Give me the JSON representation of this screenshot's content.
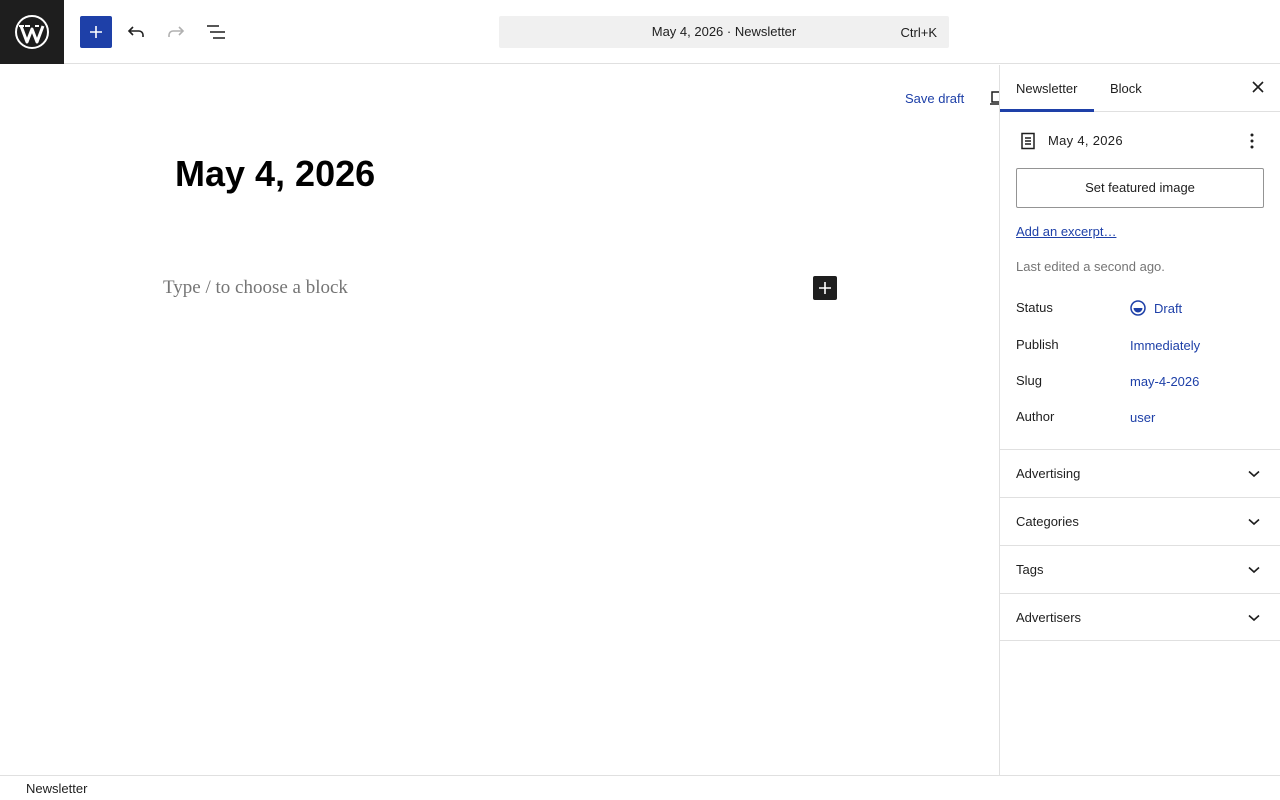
{
  "colors": {
    "accent": "#1e40a8",
    "toolbar_dark": "#1e1e1e",
    "muted_text": "#757575",
    "border": "#e0e0e0",
    "command_bg": "#f0f0f0"
  },
  "icons": {
    "logo": "wordpress-logo-icon",
    "inserter": "plus-icon",
    "undo": "undo-icon",
    "redo": "redo-icon",
    "list_view": "list-view-icon",
    "preview": "desktop-preview-icon",
    "close": "close-icon",
    "document": "post-document-icon",
    "more": "more-vertical-icon",
    "status": "draft-status-icon",
    "chevron": "chevron-down-icon"
  },
  "toolbar": {
    "command": {
      "title": "May 4, 2026 · Newsletter",
      "shortcut": "Ctrl+K"
    }
  },
  "editor": {
    "save_draft": "Save draft",
    "post_title": "May 4, 2026",
    "block_placeholder": "Type / to choose a block"
  },
  "sidebar": {
    "tabs": [
      {
        "label": "Newsletter",
        "active": true
      },
      {
        "label": "Block",
        "active": false
      }
    ],
    "document_title": "May 4, 2026",
    "featured_image_button": "Set featured image",
    "excerpt_link": "Add an excerpt…",
    "last_edited": "Last edited a second ago.",
    "meta": [
      {
        "label": "Status",
        "value": "Draft"
      },
      {
        "label": "Publish",
        "value": "Immediately"
      },
      {
        "label": "Slug",
        "value": "may-4-2026"
      },
      {
        "label": "Author",
        "value": "user"
      }
    ],
    "panels": [
      {
        "label": "Advertising"
      },
      {
        "label": "Categories"
      },
      {
        "label": "Tags"
      },
      {
        "label": "Advertisers"
      }
    ]
  },
  "footer": {
    "breadcrumb": "Newsletter"
  }
}
